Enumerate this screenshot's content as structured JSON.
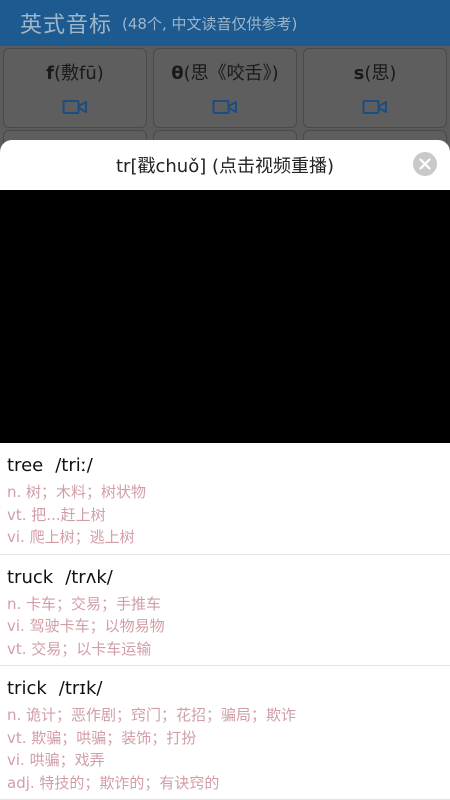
{
  "header": {
    "title": "英式音标",
    "subtitle": "(48个, 中文读音仅供参考)"
  },
  "phonemes": [
    {
      "symbol": "f",
      "hint": "(敷fū)"
    },
    {
      "symbol": "θ",
      "hint": "(思《咬舌》)"
    },
    {
      "symbol": "s",
      "hint": "(思)"
    }
  ],
  "modal": {
    "title": "tr[戳chuǒ] (点击视频重播)"
  },
  "words": [
    {
      "word": "tree",
      "phonetic": "/triː/",
      "defs": [
        "n. 树；木料；树状物",
        "vt. 把...赶上树",
        "vi. 爬上树；逃上树"
      ]
    },
    {
      "word": "truck",
      "phonetic": "/trʌk/",
      "defs": [
        "n. 卡车；交易；手推车",
        "vi. 驾驶卡车；以物易物",
        "vt. 交易；以卡车运输"
      ]
    },
    {
      "word": "trick",
      "phonetic": "/trɪk/",
      "defs": [
        "n. 诡计；恶作剧；窍门；花招；骗局；欺诈",
        "vt. 欺骗；哄骗；装饰；打扮",
        "vi. 哄骗；戏弄",
        "adj. 特技的；欺诈的；有诀窍的"
      ]
    }
  ],
  "colors": {
    "header_bg": "#1c5a8f",
    "definition_text": "#d19ea6",
    "video_bg": "#000000"
  }
}
